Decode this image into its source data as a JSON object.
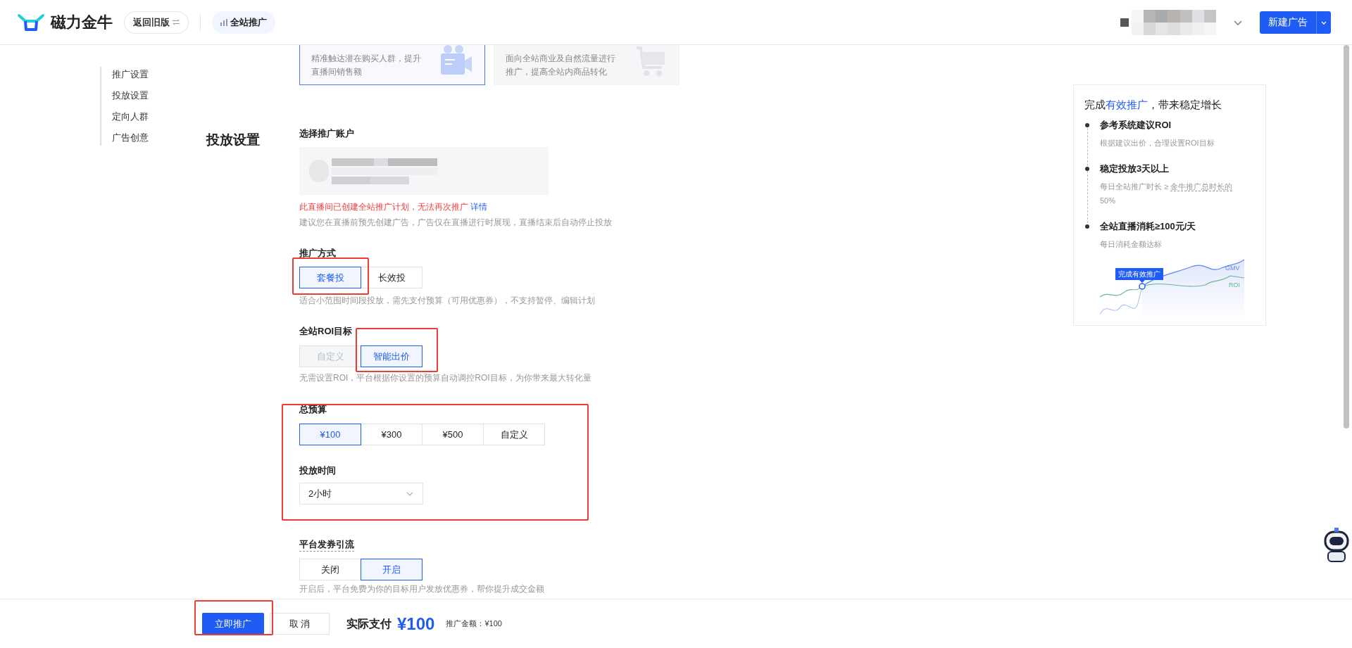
{
  "header": {
    "logo": "磁力金牛",
    "back_button": "返回旧版",
    "product_tab": "全站推广",
    "new_ad_button": "新建广告"
  },
  "nav": {
    "items": [
      {
        "label": "推广设置"
      },
      {
        "label": "投放设置"
      },
      {
        "label": "定向人群"
      },
      {
        "label": "广告创意"
      }
    ]
  },
  "cards": [
    {
      "description": "精准触达潜在购买人群，提升直播间销售额",
      "selected": true
    },
    {
      "description": "面向全站商业及自然流量进行推广，提高全站内商品转化",
      "selected": false
    }
  ],
  "section_title": "投放设置",
  "account": {
    "label": "选择推广账户",
    "error": "此直播间已创建全站推广计划，无法再次推广",
    "error_link": "详情",
    "hint": "建议您在直播前预先创建广告，广告仅在直播进行时展现，直播结束后自动停止投放"
  },
  "promo_mode": {
    "label": "推广方式",
    "options": [
      {
        "label": "套餐投",
        "selected": true,
        "disabled": false
      },
      {
        "label": "长效投",
        "selected": false,
        "disabled": false
      }
    ],
    "hint": "适合小范围时间段投放，需先支付预算（可用优惠券），不支持暂停、编辑计划"
  },
  "roi": {
    "label": "全站ROI目标",
    "options": [
      {
        "label": "自定义",
        "selected": false,
        "disabled": true
      },
      {
        "label": "智能出价",
        "selected": true,
        "disabled": false
      }
    ],
    "hint": "无需设置ROI，平台根据你设置的预算自动调控ROI目标，为你带来最大转化量"
  },
  "budget": {
    "label": "总预算",
    "options": [
      {
        "label": "¥100",
        "selected": true,
        "disabled": false
      },
      {
        "label": "¥300",
        "selected": false,
        "disabled": false
      },
      {
        "label": "¥500",
        "selected": false,
        "disabled": false
      },
      {
        "label": "自定义",
        "selected": false,
        "disabled": false
      }
    ]
  },
  "duration": {
    "label": "投放时间",
    "value": "2小时"
  },
  "coupon": {
    "label": "平台发券引流",
    "options": [
      {
        "label": "关闭",
        "selected": false,
        "disabled": false
      },
      {
        "label": "开启",
        "selected": true,
        "disabled": false
      }
    ],
    "hint": "开启后，平台免费为你的目标用户发放优惠券，帮你提升成交金额"
  },
  "footer": {
    "submit": "立即推广",
    "cancel": "取 消",
    "pay_label": "实际支付",
    "pay_amount": "¥100",
    "promo_amount": "推广金额：¥100"
  },
  "tips": {
    "title_before": "完成",
    "title_highlight": "有效推广",
    "title_after": "，带来稳定增长",
    "items": [
      {
        "title": "参考系统建议ROI",
        "desc": "根据建议出价，合理设置ROI目标"
      },
      {
        "title": "稳定投放3天以上",
        "desc": "每日全站推广时长 ≥ ",
        "dotted": "金牛推广总时长的",
        "after": "50%"
      },
      {
        "title": "全站直播消耗≥100元/天",
        "desc": "每日消耗金额达标"
      }
    ],
    "chart": {
      "tag": "完成有效推广",
      "series": [
        "GMV",
        "ROI"
      ]
    }
  }
}
